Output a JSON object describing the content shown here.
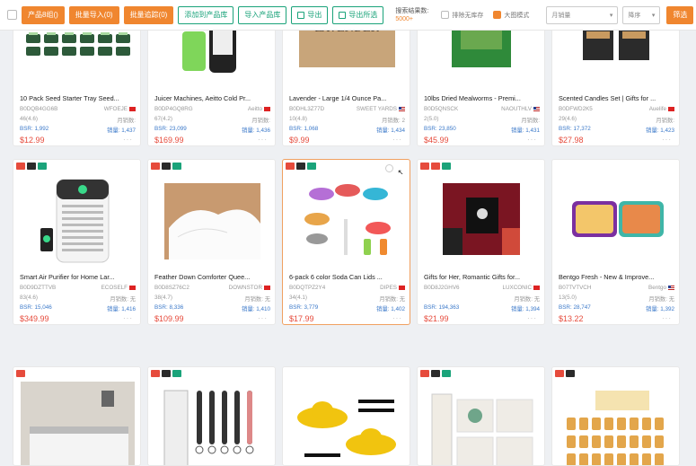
{
  "toolbar": {
    "buttons_orange": [
      "产品8组()",
      "批量导入(0)",
      "批量追踪(0)"
    ],
    "buttons_green": [
      "添加到产品库",
      "导入产品库",
      "导出",
      "导出所选"
    ],
    "note_line1": "搜索结果数:",
    "note_line2": "5000+",
    "option1": "排除无库存",
    "option2": "大图模式",
    "sort_select": "月销量",
    "order_select": "降序",
    "search_button": "筛选"
  },
  "labels": {
    "sales_label": "月销数:",
    "bsr_prefix": "BSR:",
    "volume_prefix": "销量:",
    "more": "···"
  },
  "products": [
    {
      "title": "10 Pack Seed Starter Tray Seed...",
      "asin": "B0DQB4GG6B",
      "seller": "WFOEJE",
      "flag": "cn",
      "rating": "46(4.6)",
      "sold": "",
      "bsr": "1,992",
      "volume": "1,437",
      "price": "$12.99",
      "image": "trays",
      "tags": []
    },
    {
      "title": "Juicer Machines, Aeitto Cold Pr...",
      "asin": "B0DP4GQ8RG",
      "seller": "Aeitto",
      "flag": "cn",
      "rating": "67(4.2)",
      "sold": "",
      "bsr": "23,099",
      "volume": "1,436",
      "price": "$169.99",
      "image": "juicer",
      "tags": []
    },
    {
      "title": "Lavender - Large 1/4 Ounce Pa...",
      "asin": "B0DHL3Z77D",
      "seller": "SWEET YARDS",
      "flag": "us",
      "rating": "10(4.8)",
      "sold": "2",
      "bsr": "1,068",
      "volume": "1,434",
      "price": "$9.99",
      "image": "lavender",
      "tags": []
    },
    {
      "title": "10lbs Dried Mealworms - Premi...",
      "asin": "B0D5QNSCK",
      "seller": "NAOUTHLV",
      "flag": "us",
      "rating": "2(5.0)",
      "sold": "",
      "bsr": "23,850",
      "volume": "1,431",
      "price": "$45.99",
      "image": "mealworms",
      "tags": []
    },
    {
      "title": "Scented Candles Set | Gifts for ...",
      "asin": "B0DFWD2K5",
      "seller": "Auelife",
      "flag": "cn",
      "rating": "29(4.6)",
      "sold": "",
      "bsr": "17,372",
      "volume": "1,423",
      "price": "$27.98",
      "image": "candles",
      "tags": []
    },
    {
      "title": "Smart Air Purifier for Home Lar...",
      "asin": "B0D9DZTTVB",
      "seller": "ECOSELF",
      "flag": "cn",
      "rating": "83(4.6)",
      "sold": "无",
      "bsr": "15,046",
      "volume": "1,416",
      "price": "$349.99",
      "image": "purifier",
      "tags": [
        "r",
        "k",
        "g"
      ]
    },
    {
      "title": "Feather Down Comforter Quee...",
      "asin": "B0D8SZ76C2",
      "seller": "DOWNSTOR",
      "flag": "cn",
      "rating": "38(4.7)",
      "sold": "无",
      "bsr": "8,336",
      "volume": "1,410",
      "price": "$109.99",
      "image": "comforter",
      "tags": [
        "r",
        "k",
        "g"
      ]
    },
    {
      "title": "6-pack 6 color Soda Can Lids ...",
      "asin": "B0DQTPZ2Y4",
      "seller": "DIPES",
      "flag": "cn",
      "rating": "34(4.1)",
      "sold": "无",
      "bsr": "3,779",
      "volume": "1,402",
      "price": "$17.99",
      "image": "lids",
      "tags": [
        "r",
        "k",
        "g"
      ]
    },
    {
      "title": "Gifts for Her, Romantic Gifts for...",
      "asin": "B0D8J2GHV6",
      "seller": "LUXCONIC",
      "flag": "cn",
      "rating": "",
      "sold": "无",
      "bsr": "194,363",
      "volume": "1,394",
      "price": "$21.99",
      "image": "gifts",
      "tags": [
        "r",
        "r",
        "g"
      ]
    },
    {
      "title": "Bentgo Fresh - New & Improve...",
      "asin": "B07TVTVCH",
      "seller": "Bentgo",
      "flag": "us",
      "rating": "13(5.0)",
      "sold": "无",
      "bsr": "28,747",
      "volume": "1,392",
      "price": "$13.22",
      "image": "bento",
      "tags": []
    },
    {
      "title": "",
      "asin": "",
      "seller": "",
      "flag": "",
      "rating": "",
      "sold": "",
      "bsr": "",
      "volume": "",
      "price": "",
      "image": "bedroom",
      "tags": [
        "r"
      ]
    },
    {
      "title": "",
      "asin": "",
      "seller": "",
      "flag": "",
      "rating": "",
      "sold": "",
      "bsr": "",
      "volume": "",
      "price": "",
      "image": "frothers",
      "tags": [
        "r",
        "k",
        "g"
      ]
    },
    {
      "title": "",
      "asin": "",
      "seller": "",
      "flag": "",
      "rating": "",
      "sold": "",
      "bsr": "",
      "volume": "",
      "price": "",
      "image": "hats",
      "tags": []
    },
    {
      "title": "",
      "asin": "",
      "seller": "",
      "flag": "",
      "rating": "",
      "sold": "",
      "bsr": "",
      "volume": "",
      "price": "",
      "image": "pillows",
      "tags": [
        "r",
        "k",
        "g"
      ]
    },
    {
      "title": "",
      "asin": "",
      "seller": "",
      "flag": "",
      "rating": "",
      "sold": "",
      "bsr": "",
      "volume": "",
      "price": "",
      "image": "honeyjars",
      "tags": [
        "r",
        "k"
      ]
    }
  ]
}
